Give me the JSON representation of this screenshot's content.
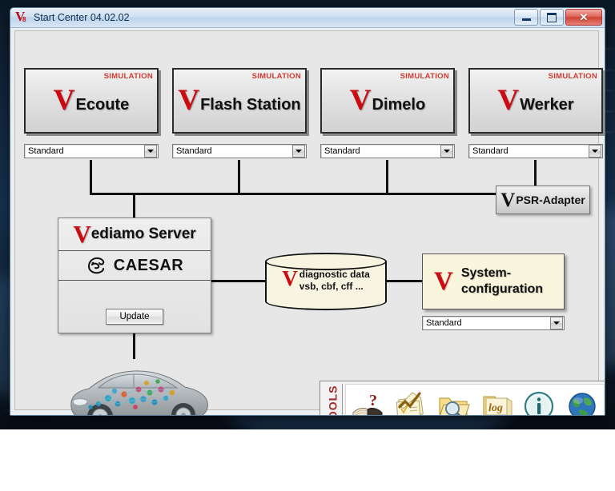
{
  "window": {
    "title": "Start Center 04.02.02",
    "logo_letter": "V",
    "logo_sub": "8",
    "buttons": {
      "minimize": "minimize-button",
      "maximize": "maximize-button",
      "close_glyph": "✕"
    }
  },
  "apps": [
    {
      "v": "V",
      "name": "Ecoute",
      "badge": "SIMULATION",
      "profile": "Standard"
    },
    {
      "v": "V",
      "name": "Flash Station",
      "badge": "SIMULATION",
      "profile": "Standard"
    },
    {
      "v": "V",
      "name": "Dimelo",
      "badge": "SIMULATION",
      "profile": "Standard"
    },
    {
      "v": "V",
      "name": "Werker",
      "badge": "SIMULATION",
      "profile": "Standard"
    }
  ],
  "psr_adapter": {
    "v": "V",
    "label": "PSR-Adapter"
  },
  "server": {
    "v": "V",
    "name": "ediamo Server",
    "caesar_label": "CAESAR",
    "update_label": "Update"
  },
  "database": {
    "v": "V",
    "line1": "diagnostic data",
    "line2": "vsb, cbf, cff ..."
  },
  "system_config": {
    "v": "V",
    "line1": "System-",
    "line2": "configuration",
    "profile": "Standard"
  },
  "tools": {
    "label": "TOOLS",
    "items": [
      {
        "icon": "help-book-icon",
        "title": "Help"
      },
      {
        "icon": "checklist-icon",
        "title": "Checklist"
      },
      {
        "icon": "folder-search-icon",
        "title": "Browse"
      },
      {
        "icon": "log-folder-icon",
        "title": "log"
      },
      {
        "icon": "info-icon",
        "title": "Info"
      },
      {
        "icon": "globe-icon",
        "title": "Web"
      }
    ],
    "log_text": "log",
    "info_glyph": "i",
    "question_glyph": "?"
  }
}
